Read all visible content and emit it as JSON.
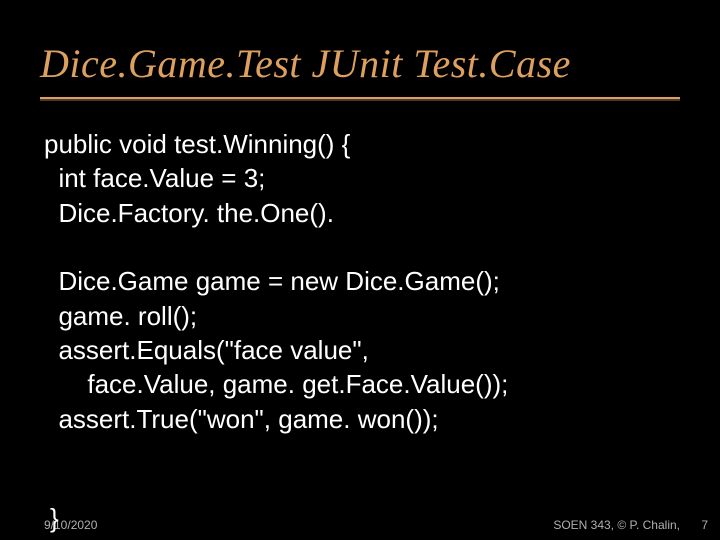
{
  "title": "Dice.Game.Test JUnit Test.Case",
  "code": {
    "l1": "public void test.Winning() {",
    "l2": "  int face.Value = 3;",
    "l3": "  Dice.Factory. the.One().",
    "l4": "",
    "l5": "  Dice.Game game = new Dice.Game();",
    "l6": "  game. roll();",
    "l7": "  assert.Equals(\"face value\",",
    "l8": "      face.Value, game. get.Face.Value());",
    "l9": "  assert.True(\"won\", game. won());"
  },
  "footer": {
    "date": "9/10/2020",
    "brace": "}",
    "right": "SOEN 343, © P. Chalin,",
    "page": "7"
  }
}
